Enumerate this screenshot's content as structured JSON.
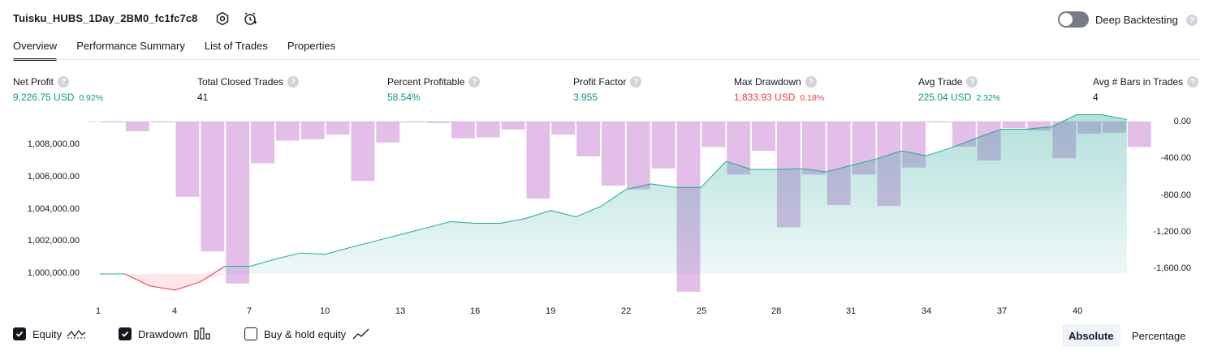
{
  "header": {
    "title": "Tuisku_HUBS_1Day_2BM0_fc1fc7c8",
    "deep_backtesting_label": "Deep Backtesting",
    "help_glyph": "?"
  },
  "tabs": [
    {
      "label": "Overview",
      "active": true
    },
    {
      "label": "Performance Summary",
      "active": false
    },
    {
      "label": "List of Trades",
      "active": false
    },
    {
      "label": "Properties",
      "active": false
    }
  ],
  "metrics": [
    {
      "label": "Net Profit",
      "value": "9,226.75 USD",
      "pct": "0.92%",
      "color": "green"
    },
    {
      "label": "Total Closed Trades",
      "value": "41",
      "pct": "",
      "color": "dark"
    },
    {
      "label": "Percent Profitable",
      "value": "58.54%",
      "pct": "",
      "color": "green"
    },
    {
      "label": "Profit Factor",
      "value": "3.955",
      "pct": "",
      "color": "green"
    },
    {
      "label": "Max Drawdown",
      "value": "1,833.93 USD",
      "pct": "0.18%",
      "color": "red"
    },
    {
      "label": "Avg Trade",
      "value": "225.04 USD",
      "pct": "2.32%",
      "color": "green"
    },
    {
      "label": "Avg # Bars in Trades",
      "value": "4",
      "pct": "",
      "color": "dark"
    }
  ],
  "chart_data": {
    "type": "line",
    "x": [
      1,
      2,
      3,
      4,
      5,
      6,
      7,
      8,
      9,
      10,
      11,
      12,
      13,
      14,
      15,
      16,
      17,
      18,
      19,
      20,
      21,
      22,
      23,
      24,
      25,
      26,
      27,
      28,
      29,
      30,
      31,
      32,
      33,
      34,
      35,
      36,
      37,
      38,
      39,
      40,
      41,
      42
    ],
    "x_ticks": [
      "1",
      "4",
      "7",
      "10",
      "13",
      "16",
      "19",
      "22",
      "25",
      "28",
      "31",
      "34",
      "37",
      "40"
    ],
    "y_left_ticks": [
      "1,000,000.00",
      "1,002,000.00",
      "1,004,000.00",
      "1,006,000.00",
      "1,008,000.00"
    ],
    "y_left_range": [
      998000,
      1009500
    ],
    "y_right_ticks": [
      "0.00",
      "-400.00",
      "-800.00",
      "-1,200.00",
      "-1,600.00"
    ],
    "y_right_range": [
      -1833.93,
      0
    ],
    "series": [
      {
        "name": "Equity",
        "color": "#26a69a",
        "negative_color": "#f23645",
        "baseline": 1000000,
        "values": [
          1000000,
          1000000,
          999250,
          999000,
          999500,
          1000480,
          1000480,
          1000920,
          1001300,
          1001230,
          1001650,
          1002050,
          1002450,
          1002850,
          1003250,
          1003150,
          1003150,
          1003450,
          1003950,
          1003550,
          1004200,
          1005250,
          1005600,
          1005380,
          1005380,
          1007000,
          1006500,
          1006500,
          1006550,
          1006350,
          1006750,
          1007150,
          1007650,
          1007350,
          1007850,
          1008450,
          1009000,
          1009000,
          1009150,
          1009900,
          1009900,
          1009600
        ]
      },
      {
        "name": "Drawdown",
        "color": "#ce93d8",
        "values": [
          -5,
          -105,
          -5,
          -810,
          -1400,
          -1745,
          -450,
          -205,
          -190,
          -140,
          -640,
          -225,
          -5,
          -15,
          -180,
          -170,
          -85,
          -830,
          -140,
          -375,
          -690,
          -730,
          -505,
          -1833.93,
          -275,
          -570,
          -315,
          -1140,
          -570,
          -900,
          -570,
          -910,
          -495,
          -5,
          -270,
          -420,
          -70,
          -95,
          -395,
          -130,
          -120,
          -275
        ]
      }
    ]
  },
  "legend": {
    "equity_label": "Equity",
    "drawdown_label": "Drawdown",
    "buyhold_label": "Buy & hold equity",
    "equity_checked": true,
    "drawdown_checked": true,
    "buyhold_checked": false
  },
  "view_toggle": {
    "absolute_label": "Absolute",
    "percentage_label": "Percentage",
    "selected": "Absolute"
  },
  "colors": {
    "accent": "#131722",
    "green": "#089981",
    "red": "#f23645",
    "equity_line": "#26a69a",
    "drawdown_bar": "#ce93d8"
  }
}
